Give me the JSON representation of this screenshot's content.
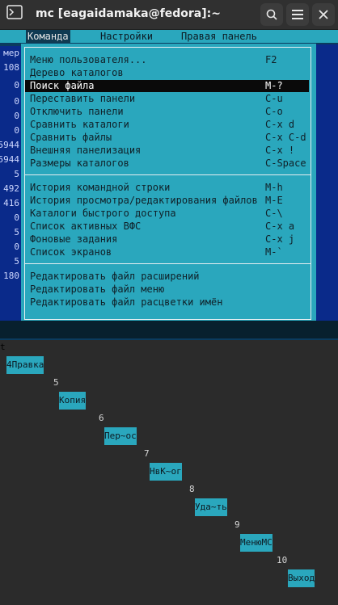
{
  "window": {
    "title": "mc [eagaidamaka@fedora]:~",
    "icons": {
      "terminal": "terminal-icon",
      "search": "search-icon",
      "menu": "hamburger-menu-icon",
      "close": "close-icon"
    }
  },
  "menubar": {
    "items": [
      {
        "label": "Команда",
        "active": true
      },
      {
        "label": "Настройки"
      },
      {
        "label": "Правая панель"
      }
    ]
  },
  "left_panel_values": [
    "мер",
    "108",
    "0",
    "0",
    "0",
    "0",
    "5944",
    "5944",
    "5",
    "492",
    "416",
    "0",
    "5",
    "0",
    "5",
    "180"
  ],
  "menu": {
    "group1": [
      {
        "label": "Меню пользователя...",
        "key": "F2"
      },
      {
        "label": "Дерево каталогов",
        "key": ""
      },
      {
        "label": "Поиск файла",
        "key": "M-?",
        "selected": true
      },
      {
        "label": "Переставить панели",
        "key": "C-u"
      },
      {
        "label": "Отключить панели",
        "key": "C-o"
      },
      {
        "label": "Сравнить каталоги",
        "key": "C-x d"
      },
      {
        "label": "Сравнить файлы",
        "key": "C-x C-d"
      },
      {
        "label": "Внешняя панелизация",
        "key": "C-x !"
      },
      {
        "label": "Размеры каталогов",
        "key": "C-Space"
      }
    ],
    "group2": [
      {
        "label": "История командной строки",
        "key": "M-h"
      },
      {
        "label": "История просмотра/редактирования файлов",
        "key": "M-E"
      },
      {
        "label": "Каталоги быстрого доступа",
        "key": "C-\\"
      },
      {
        "label": "Список активных ВФС",
        "key": "C-x a"
      },
      {
        "label": "Фоновые задания",
        "key": "C-x j"
      },
      {
        "label": "Список экранов",
        "key": "M-`"
      }
    ],
    "group3": [
      {
        "label": "Редактировать файл расширений",
        "key": ""
      },
      {
        "label": "Редактировать файл меню",
        "key": ""
      },
      {
        "label": "Редактировать файл расцветки имён",
        "key": ""
      }
    ]
  },
  "cmdline": {
    "prompt": "t"
  },
  "fkeys": [
    {
      "n": "r",
      "t": "4Правка"
    },
    {
      "n": "5",
      "t": "Копия"
    },
    {
      "n": "6",
      "t": "Пер~ос"
    },
    {
      "n": "7",
      "t": "НвК~ог"
    },
    {
      "n": "8",
      "t": "Уда~ть"
    },
    {
      "n": "9",
      "t": "МенюМС"
    },
    {
      "n": "10",
      "t": "Выход"
    }
  ]
}
